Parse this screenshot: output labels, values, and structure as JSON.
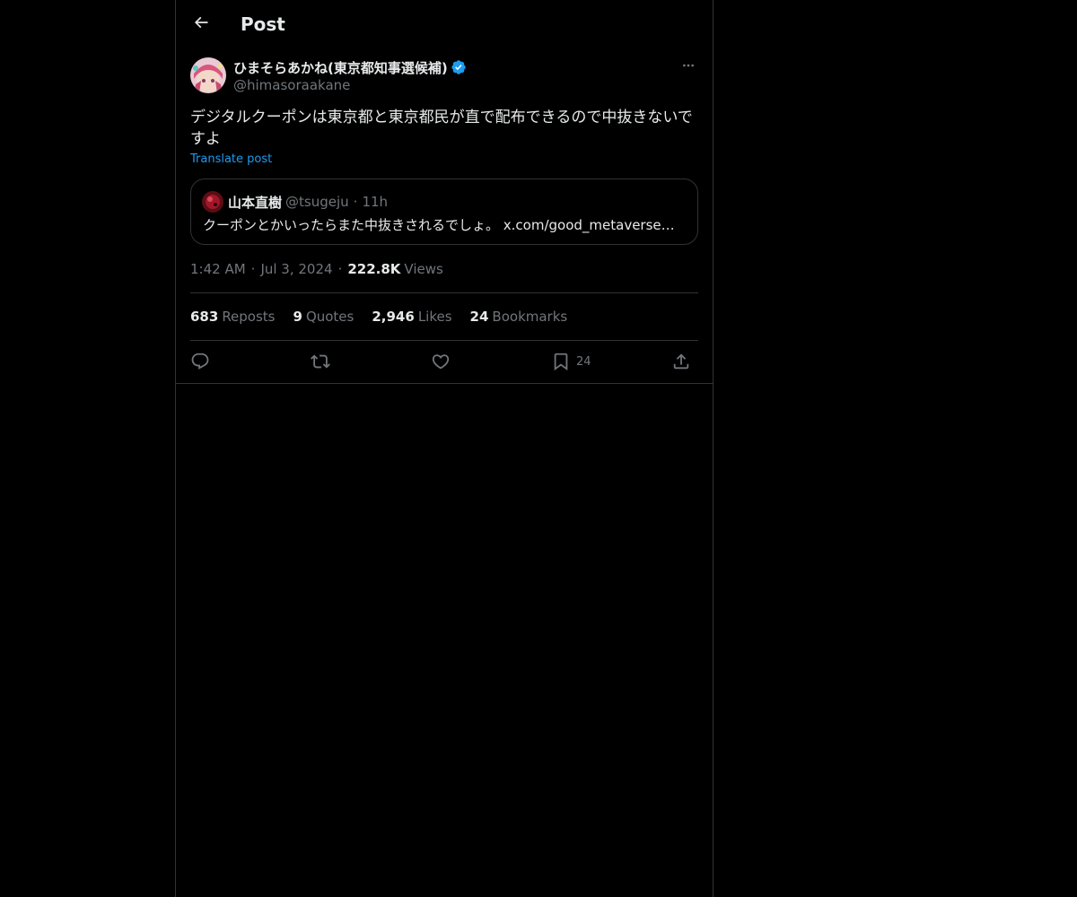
{
  "header": {
    "title": "Post",
    "back_icon": "arrow-left-icon"
  },
  "post": {
    "author": {
      "display_name": "ひまそらあかね(東京都知事選候補)",
      "handle": "@himasoraakane",
      "verified": true,
      "verified_color": "#1d9bf0"
    },
    "text": "デジタルクーポンは東京都と東京都民が直で配布できるので中抜きないですよ",
    "translate_label": "Translate post",
    "quote": {
      "display_name": "山本直樹",
      "handle": "@tsugeju",
      "dot": "·",
      "time": "11h",
      "text": "クーポンとかいったらまた中抜きされるでしょ。 x.com/good_metaverse…"
    },
    "meta": {
      "time": "1:42 AM",
      "sep1": "·",
      "date": "Jul 3, 2024",
      "sep2": "·",
      "views_count": "222.8K",
      "views_label": "Views"
    },
    "stats": {
      "reposts_count": "683",
      "reposts_label": "Reposts",
      "quotes_count": "9",
      "quotes_label": "Quotes",
      "likes_count": "2,946",
      "likes_label": "Likes",
      "bookmarks_count": "24",
      "bookmarks_label": "Bookmarks"
    },
    "actions": {
      "reply_icon": "reply-icon",
      "repost_icon": "repost-icon",
      "like_icon": "heart-icon",
      "bookmark_icon": "bookmark-icon",
      "bookmark_count": "24",
      "share_icon": "share-icon"
    }
  },
  "colors": {
    "background": "#000000",
    "text_primary": "#e7e9ea",
    "text_secondary": "#71767b",
    "border": "#2f3336",
    "accent": "#1d9bf0"
  }
}
